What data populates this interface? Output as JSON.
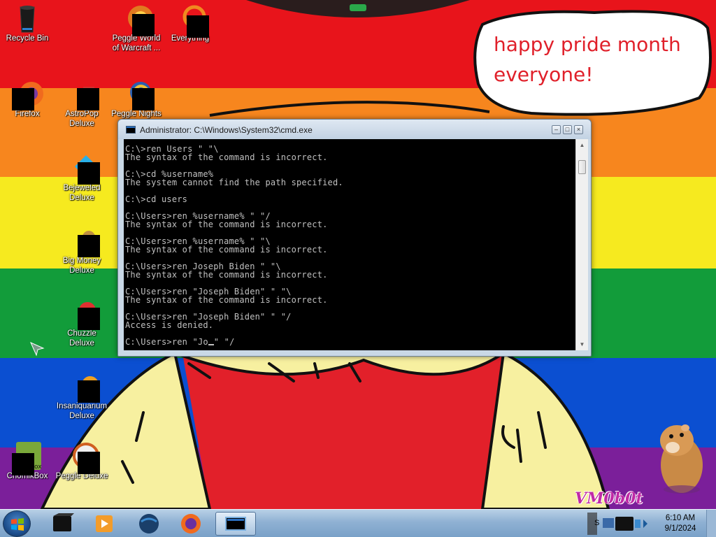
{
  "bubble": {
    "line1": "happy pride month",
    "line2": "everyone!"
  },
  "watermark": "VM0b0t",
  "desktop_icons": [
    {
      "label": "Recycle Bin",
      "icon": "recycle-bin-icon"
    },
    {
      "label": "Peggle World of Warcraft ...",
      "icon": "peggle-wow-icon"
    },
    {
      "label": "Everything",
      "icon": "everything-search-icon"
    },
    {
      "label": "Firefox",
      "icon": "firefox-icon"
    },
    {
      "label": "AstroPop Deluxe",
      "icon": "astropop-icon"
    },
    {
      "label": "Peggle Nights",
      "icon": "peggle-nights-icon"
    },
    {
      "label": "Bejeweled Deluxe",
      "icon": "bejeweled-icon"
    },
    {
      "label": "Big Money Deluxe",
      "icon": "big-money-icon"
    },
    {
      "label": "Chuzzle Deluxe",
      "icon": "chuzzle-icon"
    },
    {
      "label": "Insaniquarium Deluxe",
      "icon": "insaniquarium-icon"
    },
    {
      "label": "ChomikBox",
      "icon": "chomikbox-icon"
    },
    {
      "label": "Peggle Deluxe",
      "icon": "peggle-deluxe-icon"
    }
  ],
  "cmd": {
    "title": "Administrator: C:\\Windows\\System32\\cmd.exe",
    "lines": [
      "C:\\>ren Users \" \"\\",
      "The syntax of the command is incorrect.",
      "",
      "C:\\>cd %username%",
      "The system cannot find the path specified.",
      "",
      "C:\\>cd users",
      "",
      "C:\\Users>ren %username% \" \"/",
      "The syntax of the command is incorrect.",
      "",
      "C:\\Users>ren %username% \" \"\\",
      "The syntax of the command is incorrect.",
      "",
      "C:\\Users>ren Joseph Biden \" \"\\",
      "The syntax of the command is incorrect.",
      "",
      "C:\\Users>ren \"Joseph Biden\" \" \"\\",
      "The syntax of the command is incorrect.",
      "",
      "C:\\Users>ren \"Joseph Biden\" \" \"/",
      "Access is denied.",
      ""
    ],
    "prompt_before_cursor": "C:\\Users>ren \"Jo",
    "prompt_after_cursor": "\" \"/",
    "buttons": {
      "minimize": "minimize",
      "maximize": "maximize",
      "close": "close"
    }
  },
  "taskbar": {
    "start": "start-orb",
    "pinned": [
      {
        "name": "taskbar-app-black-box",
        "icon": "black-box-icon"
      },
      {
        "name": "taskbar-media-player",
        "icon": "media-player-icon"
      },
      {
        "name": "taskbar-globe",
        "icon": "globe-icon"
      },
      {
        "name": "taskbar-firefox",
        "icon": "firefox-icon"
      },
      {
        "name": "taskbar-cmd",
        "icon": "cmd-icon",
        "active": true
      }
    ],
    "tray_text": "S",
    "clock_time": "6:10 AM",
    "clock_date": "9/1/2024"
  },
  "colors": {
    "stripes": [
      "#e8141b",
      "#f7861e",
      "#f6ea1f",
      "#129c3a",
      "#0b4fd1",
      "#7b1f9a"
    ],
    "bubble_text": "#e0202a",
    "cmd_bg": "#000000",
    "cmd_fg": "#c0c0c0"
  }
}
